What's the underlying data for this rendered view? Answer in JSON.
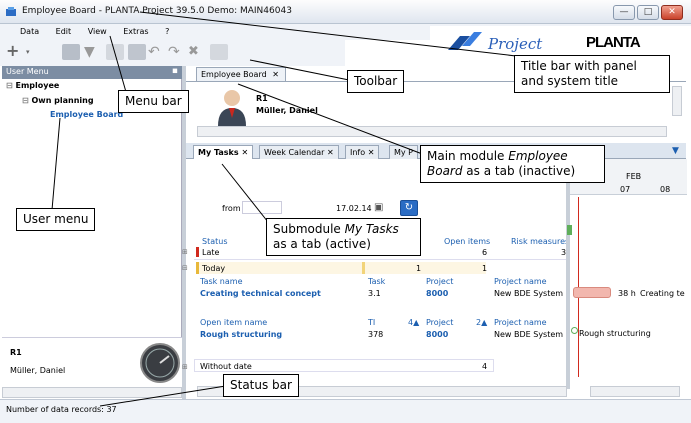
{
  "window": {
    "title": "Employee Board - PLANTA Project 39.5.0 Demo: MAIN46043"
  },
  "menu": [
    "Data",
    "Edit",
    "View",
    "Extras",
    "?"
  ],
  "logo": {
    "product": "Project",
    "brand": "PLANTA"
  },
  "user_menu": {
    "header": "User Menu",
    "items": [
      {
        "label": "Employee",
        "level": 0
      },
      {
        "label": "Own planning",
        "level": 1
      },
      {
        "label": "Employee Board",
        "level": 2
      }
    ]
  },
  "employee": {
    "id": "R1",
    "name": "Müller, Daniel"
  },
  "main_tab": {
    "label": "Employee Board"
  },
  "sub_tabs": [
    "My Tasks",
    "Week Calendar",
    "Info",
    "My P"
  ],
  "filter": {
    "from_label": "from",
    "date": "17.02.14"
  },
  "columns": {
    "status": "Status",
    "open_items": "Open items",
    "risk": "Risk measures"
  },
  "groups": [
    {
      "label": "Late",
      "open_items": "6",
      "risk": "3"
    },
    {
      "label": "Today",
      "col1": "1",
      "open_items": "1"
    },
    {
      "label": "Without date",
      "open_items": "4"
    }
  ],
  "task_table": {
    "headers": [
      "Task name",
      "Task",
      "Project",
      "Project name"
    ],
    "row": [
      "Creating technical concept",
      "3.1",
      "8000",
      "New BDE System"
    ]
  },
  "open_item_table": {
    "headers": [
      "Open item name",
      "TI",
      "4",
      "Project",
      "2",
      "Project name"
    ],
    "row": [
      "Rough structuring",
      "378",
      "8000",
      "New BDE System"
    ]
  },
  "gantt": {
    "month": "FEB",
    "days": [
      "07",
      "08"
    ],
    "bar_label": "38 h",
    "bar_text": "Creating te",
    "milestone_text": "Rough structuring"
  },
  "status": {
    "text": "Number of data records: 37"
  },
  "callouts": {
    "title_bar": "Title bar with panel and system title",
    "toolbar": "Toolbar",
    "menu_bar": "Menu bar",
    "main_module": [
      "Main module ",
      "Employee Board",
      " as a tab (inactive)"
    ],
    "user_menu": "User menu",
    "submodule": [
      "Submodule ",
      "My Tasks",
      " as a tab (active)"
    ],
    "status_bar": "Status bar"
  }
}
